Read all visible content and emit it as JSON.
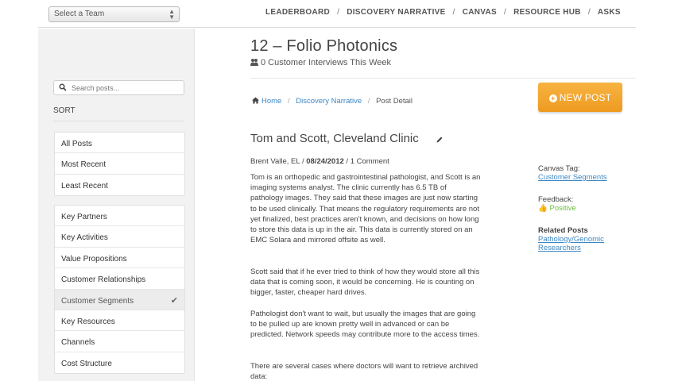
{
  "header": {
    "team_select": "Select a Team",
    "nav": [
      "LEADERBOARD",
      "DISCOVERY NARRATIVE",
      "CANVAS",
      "RESOURCE HUB",
      "ASKS"
    ],
    "nav_separator": "/"
  },
  "sidebar": {
    "search_placeholder": "Search posts...",
    "sort_label": "SORT",
    "sort_items": [
      "All Posts",
      "Most Recent",
      "Least Recent"
    ],
    "canvas_items": [
      "Key Partners",
      "Key Activities",
      "Value Propositions",
      "Customer Relationships",
      "Customer Segments",
      "Key Resources",
      "Channels",
      "Cost Structure"
    ],
    "active_item": "Customer Segments"
  },
  "main": {
    "title": "12 – Folio Photonics",
    "subtitle": "0 Customer Interviews This Week",
    "breadcrumb": {
      "home": "Home",
      "section": "Discovery Narrative",
      "current": "Post Detail",
      "separator": "/"
    },
    "new_post_label": "NEW POST",
    "post": {
      "title": "Tom and Scott, Cleveland Clinic",
      "author": "Brent Valle, EL",
      "meta_sep1": " / ",
      "date": "08/24/2012",
      "meta_sep2": " / ",
      "comments": "1 Comment",
      "paragraphs": [
        "Tom is an orthopedic and gastrointestinal pathologist, and Scott is an imaging systems analyst. The clinic currently has 6.5 TB of pathology images. They said that these images are just now starting to be used clinically. That means the regulatory requirements are not yet finalized, best practices aren't known, and decisions on how long to store this data is up in the air. This data is currently stored on an EMC Solara and mirrored offsite as well.",
        "Scott said that if he ever tried to think of how they would store all this data that is coming soon, it would be concerning. He is counting on bigger, faster, cheaper hard drives.",
        "Pathologist don't want to wait, but usually the images that are going to be pulled up are known pretty well in advanced or can be predicted. Network speeds may contribute more to the access times.",
        "There are several cases where doctors will want to retrieve archived data:"
      ]
    },
    "side": {
      "canvas_tag_label": "Canvas Tag:",
      "canvas_tag_value": "Customer Segments",
      "feedback_label": "Feedback:",
      "feedback_value": "Positive",
      "related_label": "Related Posts",
      "related_link_line1": "Pathology/Genomic",
      "related_link_line2": "Researchers"
    }
  },
  "colors": {
    "accent_orange": "#ee9a20",
    "link_blue": "#3c87c4",
    "positive_green": "#6bbf3c"
  }
}
